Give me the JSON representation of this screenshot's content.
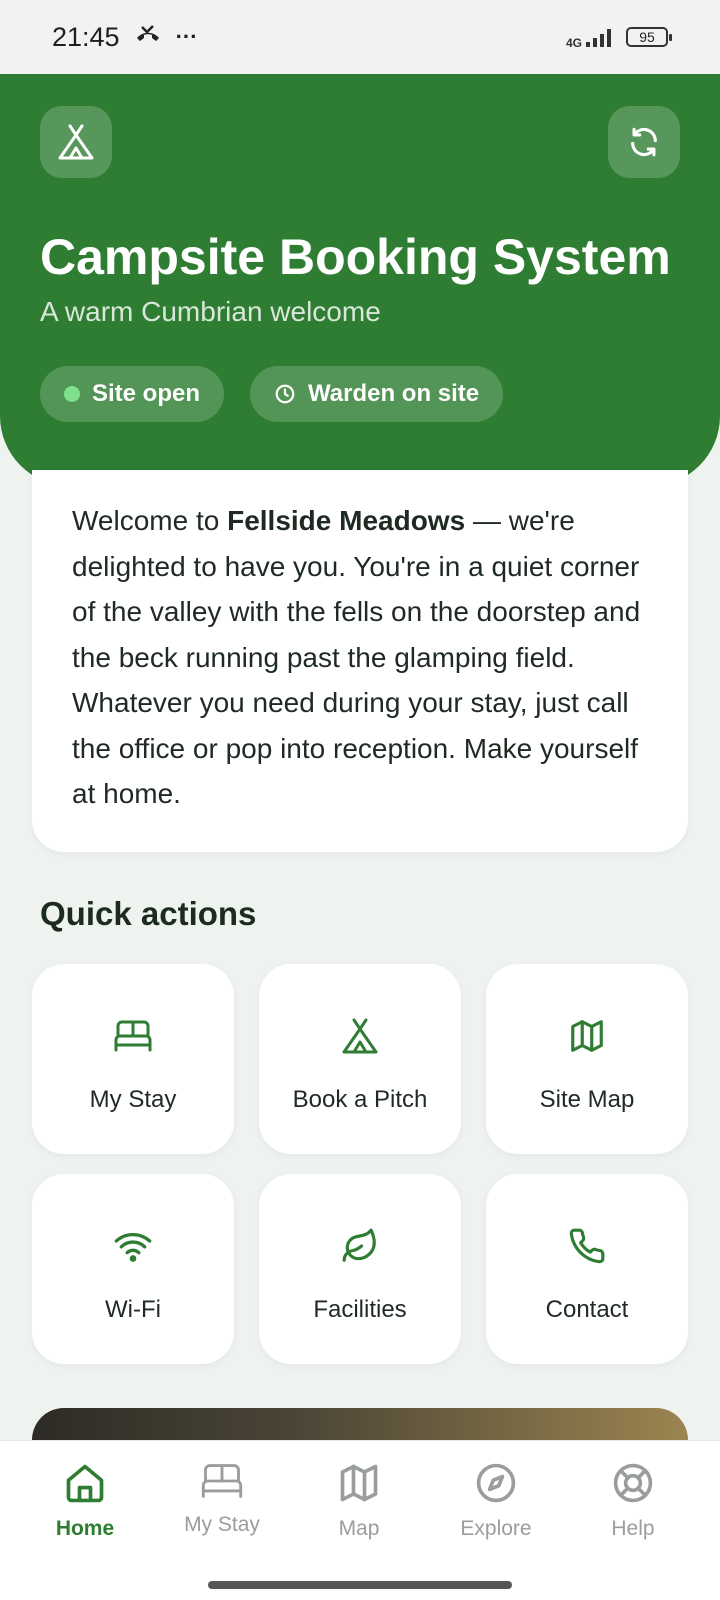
{
  "status_bar": {
    "time": "21:45",
    "more": "···",
    "network": "4G",
    "battery": "95"
  },
  "header": {
    "title": "Campsite Booking System",
    "subtitle": "A warm Cumbrian welcome",
    "badges": [
      {
        "label": "Site open",
        "icon": "status-dot"
      },
      {
        "label": "Warden on site",
        "icon": "clock-icon"
      }
    ],
    "colors": {
      "brand": "#2e7d32",
      "status_dot": "#7ee08a"
    }
  },
  "welcome": {
    "prefix": "Welcome to ",
    "site_name": "Fellside Meadows",
    "body": " — we're delighted to have you. You're in a quiet corner of the valley with the fells on the doorstep and the beck running past the glamping field. Whatever you need during your stay, just call the office or pop into reception. Make yourself at home."
  },
  "quick_actions": {
    "title": "Quick actions",
    "items": [
      {
        "label": "My Stay",
        "icon": "bed-icon"
      },
      {
        "label": "Book a Pitch",
        "icon": "tent-icon"
      },
      {
        "label": "Site Map",
        "icon": "map-icon"
      },
      {
        "label": "Wi-Fi",
        "icon": "wifi-icon"
      },
      {
        "label": "Facilities",
        "icon": "leaf-icon"
      },
      {
        "label": "Contact",
        "icon": "phone-icon"
      }
    ]
  },
  "bottom_nav": {
    "items": [
      {
        "label": "Home",
        "icon": "home-icon",
        "active": true
      },
      {
        "label": "My Stay",
        "icon": "bed-icon",
        "active": false
      },
      {
        "label": "Map",
        "icon": "map-icon",
        "active": false
      },
      {
        "label": "Explore",
        "icon": "compass-icon",
        "active": false
      },
      {
        "label": "Help",
        "icon": "lifebuoy-icon",
        "active": false
      }
    ]
  }
}
